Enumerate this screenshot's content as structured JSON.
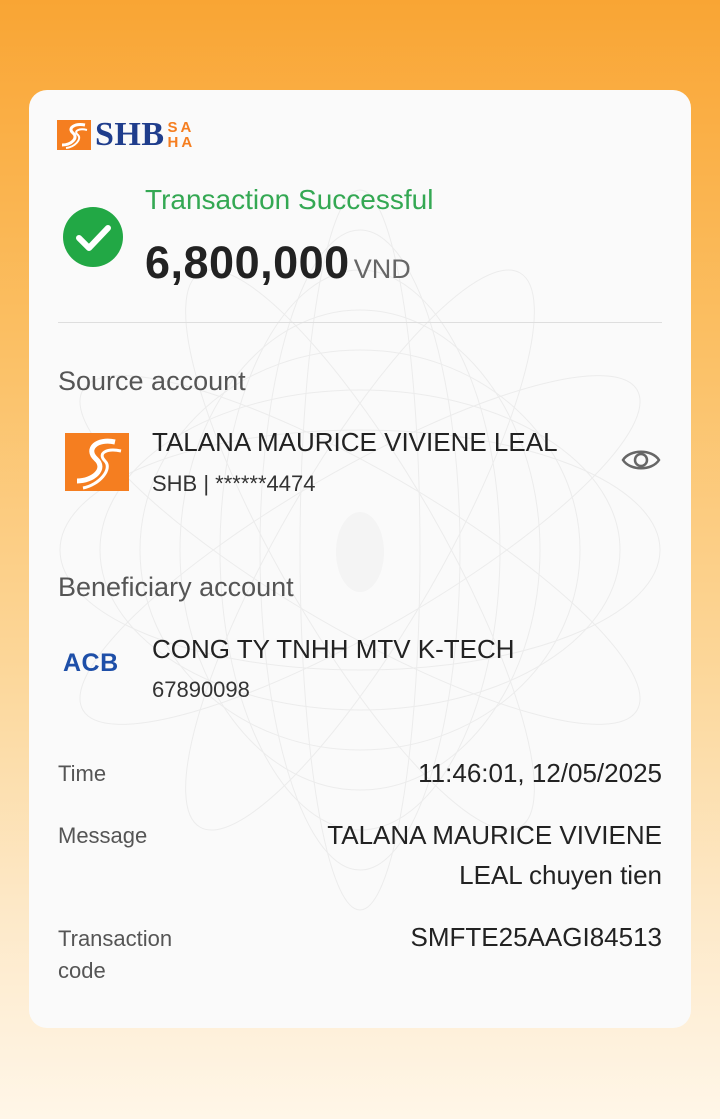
{
  "brand": {
    "name": "SHB",
    "sub_top": "SA",
    "sub_bottom": "HA",
    "primary_color": "#1f3d8c",
    "accent_color": "#f57e20"
  },
  "status": {
    "icon": "check-circle-icon",
    "title": "Transaction Successful",
    "color": "#34a853"
  },
  "amount": {
    "value": "6,800,000",
    "currency": "VND"
  },
  "source": {
    "label": "Source account",
    "bank_icon": "shb-bank-logo",
    "name": "TALANA MAURICE VIVIENE LEAL",
    "detail": "SHB | ******4474",
    "toggle_icon": "eye-icon"
  },
  "beneficiary": {
    "label": "Beneficiary account",
    "bank_logo_text": "ACB",
    "name": "CONG TY TNHH MTV K-TECH",
    "account": "67890098"
  },
  "details": {
    "time_label": "Time",
    "time_value": "11:46:01, 12/05/2025",
    "message_label": "Message",
    "message_line1": "TALANA MAURICE VIVIENE",
    "message_line2": "LEAL chuyen tien",
    "code_label_line1": "Transaction",
    "code_label_line2": "code",
    "code_value": "SMFTE25AAGI84513"
  }
}
